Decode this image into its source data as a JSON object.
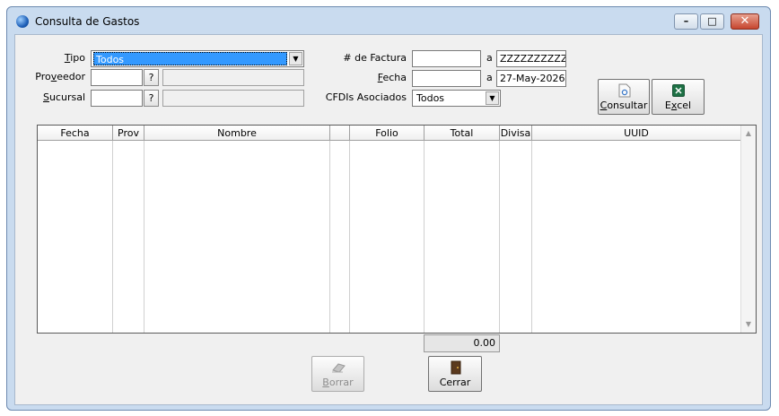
{
  "window": {
    "title": "Consulta de Gastos"
  },
  "filters": {
    "tipo": {
      "label_prefix": "",
      "label_u": "T",
      "label_rest": "ipo",
      "value": "Todos"
    },
    "proveedor": {
      "label_prefix": "Pro",
      "label_u": "v",
      "label_rest": "eedor",
      "code": "",
      "name": "",
      "help": "?"
    },
    "sucursal": {
      "label_prefix": "",
      "label_u": "S",
      "label_rest": "ucursal",
      "code": "",
      "name": "",
      "help": "?"
    },
    "factura": {
      "label": "# de Factura",
      "from": "",
      "to_label": "a",
      "to": "ZZZZZZZZZZ"
    },
    "fecha": {
      "label_prefix": "",
      "label_u": "F",
      "label_rest": "echa",
      "from": "",
      "to_label": "a",
      "to": "27-May-2026"
    },
    "cfdis": {
      "label": "CFDIs Asociados",
      "value": "Todos"
    }
  },
  "actions": {
    "consultar": {
      "label_prefix": "",
      "label_u": "C",
      "label_rest": "onsultar"
    },
    "excel": {
      "label_prefix": "E",
      "label_u": "x",
      "label_rest": "cel"
    },
    "borrar": {
      "label_prefix": "",
      "label_u": "B",
      "label_rest": "orrar"
    },
    "cerrar": {
      "label": "Cerrar"
    }
  },
  "grid": {
    "columns": [
      "Fecha",
      "Prov",
      "Nombre",
      "",
      "Folio",
      "Total",
      "Divisa",
      "UUID"
    ],
    "rows": []
  },
  "totals": {
    "total": "0.00"
  },
  "colors": {
    "titlebar": "#c9dbef",
    "selection": "#3399ff",
    "close": "#c6462f",
    "excel_green": "#1e7145"
  }
}
